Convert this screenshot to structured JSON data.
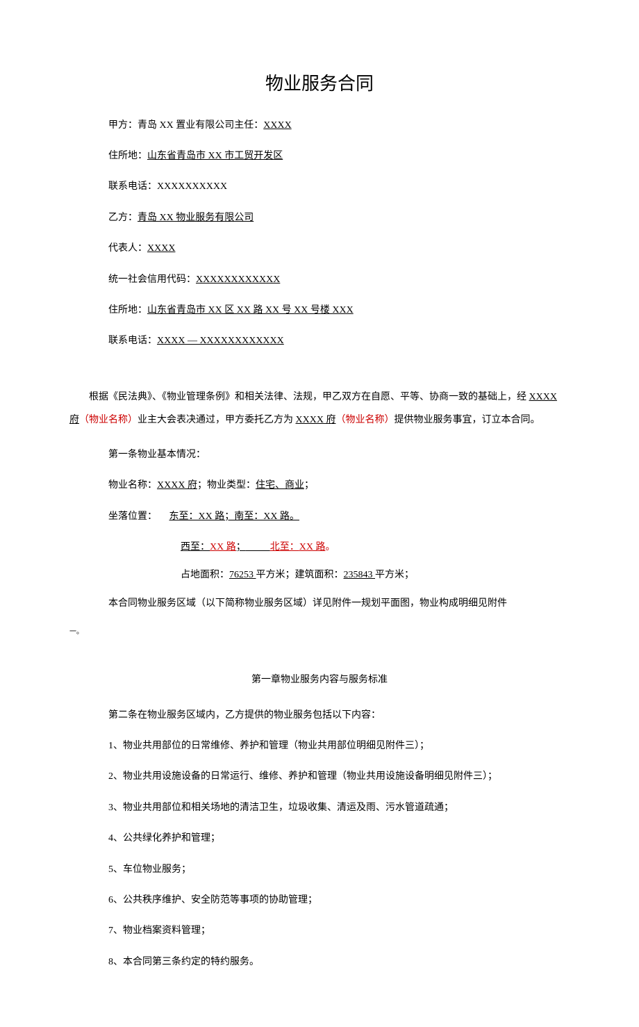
{
  "title": "物业服务合同",
  "partyA": {
    "label": "甲方：青岛 XX 置业有限公司主任：",
    "name": "XXXX",
    "addressLabel": "住所地：",
    "address": "山东省青岛市 XX 市工贸开发区",
    "phoneLabel": "联系电话：",
    "phone": "XXXXXXXXXX"
  },
  "partyB": {
    "label": "乙方：",
    "name": "青岛 XX 物业服务有限公司",
    "repLabel": "代表人：",
    "rep": "XXXX",
    "creditLabel": "统一社会信用代码：",
    "credit": "XXXXXXXXXXXX",
    "addressLabel": "住所地：",
    "address": "山东省青岛市 XX 区 XX 路 XX 号 XX 号楼 XXX",
    "phoneLabel": "联系电话：",
    "phone": "XXXX — XXXXXXXXXXXX"
  },
  "preamble": {
    "part1": "根据《民法典》、《物业管理条例》和相关法律、法规，甲乙双方在自愿、平等、协商一致的基础上，经 ",
    "estate1": "XXXX",
    "part2": "府",
    "note1": "（物业名称）",
    "part3": "业主大会表决通过，甲方委托乙方为 ",
    "estate2": "XXXX 府",
    "note2": "（物业名称）",
    "part4": "提供物业服务事宜，订立本合同。"
  },
  "article1": {
    "heading": "第一条物业基本情况：",
    "nameLabel": "物业名称：",
    "name": "XXXX 府",
    "typeLabel": "；物业类型：",
    "type": "住宅、商业",
    "typeEnd": "；",
    "locLabel": "坐落位置：",
    "east": "东至：XX 路；南至：XX 路。",
    "westLabel": "西至：",
    "westVal": "XX 路",
    "westSep": "；",
    "northLabel": "北至：",
    "northVal": "XX 路",
    "northEnd": "。",
    "areaLabel": "占地面积：",
    "areaVal": "76253 ",
    "areaUnit": "平方米；建筑面积：",
    "buildVal": "235843 ",
    "buildUnit": "平方米；",
    "regionText": "本合同物业服务区域（以下简称物业服务区域）详见附件一规划平面图，物业构成明细见附件",
    "mark": "一。"
  },
  "chapter1": {
    "title": "第一章物业服务内容与服务标准",
    "article2": "第二条在物业服务区域内，乙方提供的物业服务包括以下内容：",
    "items": [
      "1、物业共用部位的日常维修、养护和管理（物业共用部位明细见附件三）；",
      "2、物业共用设施设备的日常运行、维修、养护和管理（物业共用设施设备明细见附件三）；",
      "3、物业共用部位和相关场地的清洁卫生，垃圾收集、清运及雨、污水管道疏通；",
      "4、公共绿化养护和管理；",
      "5、车位物业服务；",
      "6、公共秩序维护、安全防范等事项的协助管理；",
      "7、物业档案资料管理；",
      "8、本合同第三条约定的特约服务。"
    ]
  }
}
